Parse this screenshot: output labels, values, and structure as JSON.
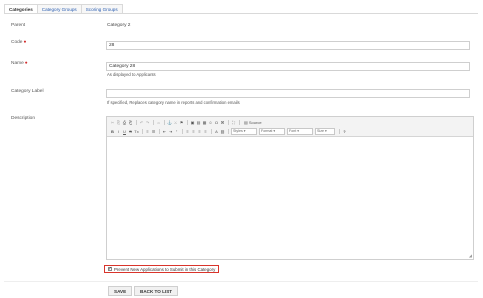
{
  "tabs": [
    {
      "label": "Categories",
      "active": true
    },
    {
      "label": "Category Groups",
      "active": false
    },
    {
      "label": "Scoring Groups",
      "active": false
    }
  ],
  "form": {
    "parent_label": "Parent",
    "parent_value": "Category 2",
    "code_label": "Code",
    "code_value": "28",
    "name_label": "Name",
    "name_value": "Category 28",
    "name_hint": "As displayed to Applicants",
    "category_label_label": "Category Label",
    "category_label_value": "",
    "category_label_hint": "If specified, Replaces category name in reports and confirmation emails",
    "description_label": "Description",
    "required_marker": "●"
  },
  "editor": {
    "row1": [
      "✂",
      "⎘",
      "⎙",
      "⎗",
      "↶",
      "↷",
      "⇔",
      "⚓",
      "⚔",
      "⚑",
      "▣",
      "▤",
      "▦",
      "☺",
      "Ω",
      "⌘",
      "⛶"
    ],
    "source_label": "Source",
    "row2": [
      "B",
      "I",
      "U",
      "S",
      "Tx",
      "≡",
      "☰",
      "⇤",
      "⇥",
      "”",
      "≡",
      "≡",
      "≡",
      "≡",
      "A",
      "▧"
    ],
    "styles": "Styles",
    "format": "Format",
    "font": "Font",
    "size": "Size",
    "help": "?"
  },
  "checkbox": {
    "label": "Prevent New Applications to Submit in this Category",
    "checked": true
  },
  "buttons": {
    "save": "SAVE",
    "back": "BACK TO LIST"
  }
}
